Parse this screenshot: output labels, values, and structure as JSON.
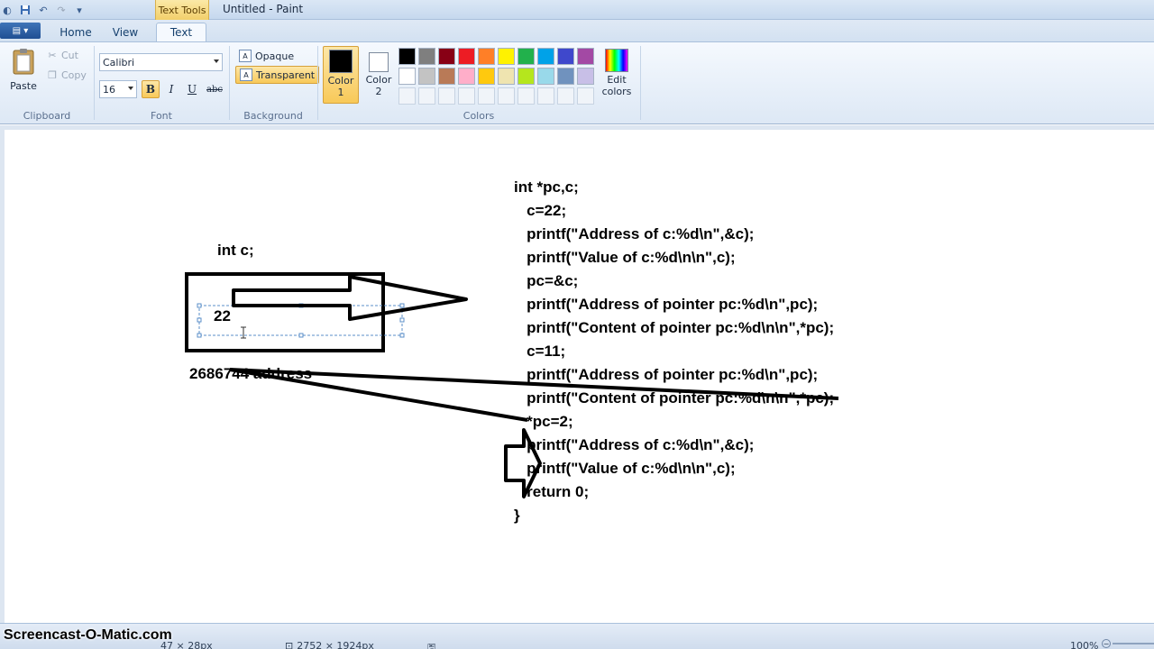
{
  "window": {
    "title": "Untitled - Paint",
    "context_tab": "Text Tools"
  },
  "quick_access": {
    "save_icon": "save-icon",
    "undo_icon": "undo-icon",
    "redo_icon": "redo-icon",
    "customize_icon": "dropdown-icon"
  },
  "tabs": [
    {
      "label": "Home"
    },
    {
      "label": "View"
    },
    {
      "label": "Text",
      "active": true
    }
  ],
  "clipboard": {
    "paste_label": "Paste",
    "cut_label": "Cut",
    "copy_label": "Copy",
    "group_label": "Clipboard"
  },
  "font": {
    "family": "Calibri",
    "size": "16",
    "bold": "B",
    "italic": "I",
    "underline": "U",
    "strikethrough": "abc",
    "group_label": "Font"
  },
  "background": {
    "opaque_label": "Opaque",
    "transparent_label": "Transparent",
    "group_label": "Background"
  },
  "colors": {
    "color1_label": "Color 1",
    "color1_value": "#000000",
    "color2_label": "Color 2",
    "color2_value": "#ffffff",
    "group_label": "Colors",
    "edit_label": "Edit colors",
    "palette": [
      "#000000",
      "#7f7f7f",
      "#880015",
      "#ed1c24",
      "#ff7f27",
      "#fff200",
      "#22b14c",
      "#00a2e8",
      "#3f48cc",
      "#a349a4",
      "#ffffff",
      "#c3c3c3",
      "#b97a57",
      "#ffaec9",
      "#ffc90e",
      "#efe4b0",
      "#b5e61d",
      "#99d9ea",
      "#7092be",
      "#c8bfe7"
    ]
  },
  "canvas": {
    "left_label": "int c;",
    "box_value": "22",
    "address_text": "2686744 address",
    "code_lines": [
      "int *pc,c;",
      "   c=22;",
      "   printf(\"Address of c:%d\\n\",&c);",
      "   printf(\"Value of c:%d\\n\\n\",c);",
      "   pc=&c;",
      "   printf(\"Address of pointer pc:%d\\n\",pc);",
      "   printf(\"Content of pointer pc:%d\\n\\n\",*pc);",
      "   c=11;",
      "   printf(\"Address of pointer pc:%d\\n\",pc);",
      "   printf(\"Content of pointer pc:%d\\n\\n\",*pc);",
      "   *pc=2;",
      "   printf(\"Address of c:%d\\n\",&c);",
      "   printf(\"Value of c:%d\\n\\n\",c);",
      "   return 0;",
      "}"
    ]
  },
  "status": {
    "watermark": "Screencast-O-Matic.com",
    "selection_size": "47 × 28px",
    "image_size": "2752 × 1924px",
    "zoom": "100%"
  }
}
